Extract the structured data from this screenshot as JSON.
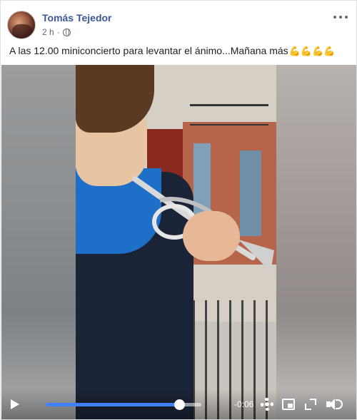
{
  "post": {
    "author": "Tomás Tejedor",
    "time": "2 h",
    "privacy_icon": "globe-icon",
    "more_icon": "more-options-icon",
    "caption": "A las 12.00 miniconcierto para levantar el ánimo...Mañana más",
    "caption_emoji": "💪💪💪💪"
  },
  "video": {
    "progress": 0.86,
    "time_remaining": "-0:06",
    "icons": [
      "play-icon",
      "settings-icon",
      "picture-in-picture-icon",
      "fullscreen-icon",
      "volume-icon"
    ],
    "progress_color": "#4080ff"
  },
  "colors": {
    "author_link": "#385898",
    "meta_text": "#606770"
  }
}
